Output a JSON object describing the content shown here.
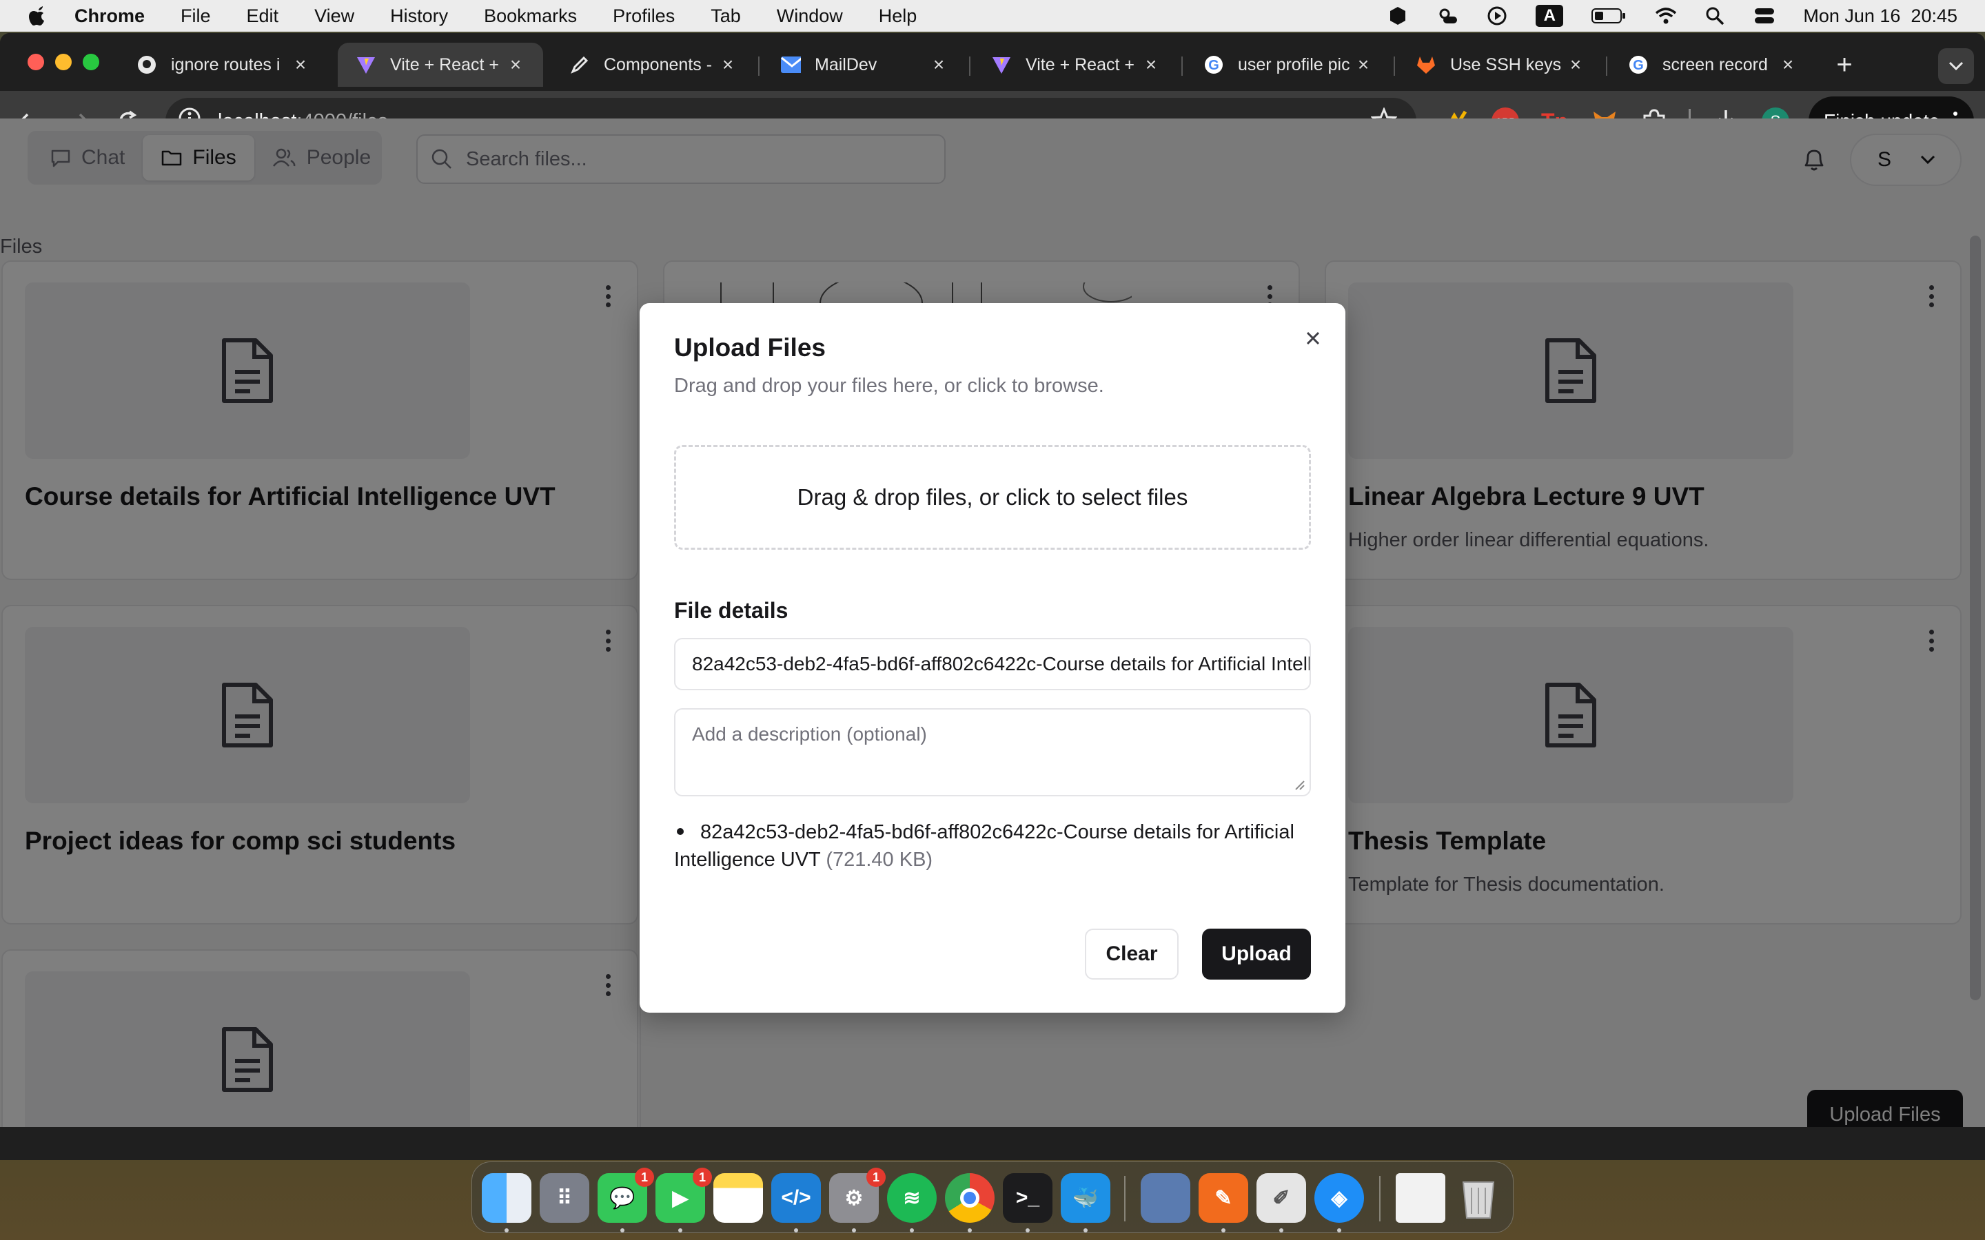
{
  "menubar": {
    "app": "Chrome",
    "items": [
      "File",
      "Edit",
      "View",
      "History",
      "Bookmarks",
      "Profiles",
      "Tab",
      "Window",
      "Help"
    ],
    "input_source": "A",
    "clock": "Mon Jun 16  20:45"
  },
  "tabs": [
    {
      "title": "ignore routes i",
      "icon": "github-icon"
    },
    {
      "title": "Vite + React +",
      "icon": "vite-icon",
      "active": true
    },
    {
      "title": "Components -",
      "icon": "pen-icon"
    },
    {
      "title": "MailDev",
      "icon": "mail-icon"
    },
    {
      "title": "Vite + React +",
      "icon": "vite-icon"
    },
    {
      "title": "user profile pic",
      "icon": "google-icon"
    },
    {
      "title": "Use SSH keys",
      "icon": "gitlab-icon"
    },
    {
      "title": "screen record",
      "icon": "google-icon"
    }
  ],
  "address": {
    "host": "localhost",
    "path": ":4000/files"
  },
  "finish_update": "Finish update",
  "profile_initial": "S",
  "app": {
    "nav": {
      "chat": "Chat",
      "files": "Files",
      "people": "People"
    },
    "search_placeholder": "Search files...",
    "user_initial": "S",
    "breadcrumb": "Files",
    "upload_button": "Upload Files",
    "cards": [
      {
        "title": "Course details for Artificial Intelligence UVT",
        "description": ""
      },
      {
        "title": "",
        "description": ""
      },
      {
        "title": "Linear Algebra Lecture 9 UVT",
        "description": "Higher order linear differential equations."
      },
      {
        "title": "Project ideas for comp sci students",
        "description": ""
      },
      {
        "title": "Thesis Template",
        "description": "Template for Thesis documentation."
      }
    ]
  },
  "modal": {
    "title": "Upload Files",
    "subtitle": "Drag and drop your files here, or click to browse.",
    "dropzone": "Drag & drop files, or click to select files",
    "details_heading": "File details",
    "filename_value": "82a42c53-deb2-4fa5-bd6f-aff802c6422c-Course details for Artificial Intelligence UVT",
    "description_placeholder": "Add a description (optional)",
    "file_list_name": "82a42c53-deb2-4fa5-bd6f-aff802c6422c-Course details for Artificial Intelligence UVT",
    "file_list_size": "(721.40 KB)",
    "clear": "Clear",
    "upload": "Upload"
  },
  "dock": {
    "badges": {
      "messages": "1",
      "facetime": "1",
      "settings": "1"
    }
  },
  "colors": {
    "primary": "#18181b",
    "muted": "#71717a",
    "border": "#e4e4e7",
    "overlay": "rgba(0,0,0,0.5)",
    "tab_active": "#3c3c3c"
  }
}
